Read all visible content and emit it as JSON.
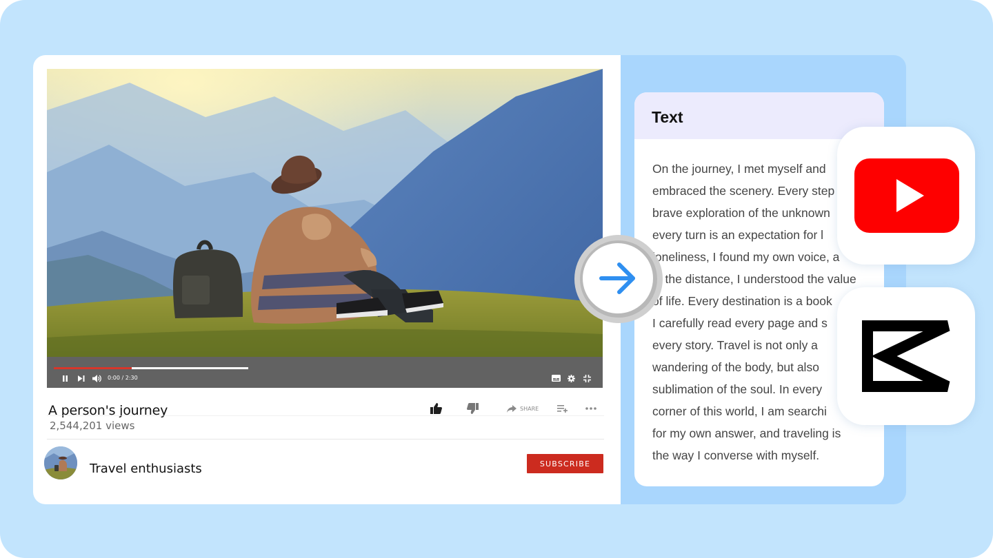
{
  "video": {
    "time": "0:00 / 2:30",
    "progress": 0.4,
    "played": 0.4,
    "title": "A person's journey",
    "views": "2,544,201 views",
    "share_label": "SHARE",
    "channel_name": "Travel enthusiasts",
    "subscribe_label": "SUBSCRIBE"
  },
  "text_panel": {
    "title": "Text",
    "lines": [
      "On the journey, I met myself and",
      "embraced the scenery. Every step",
      "brave exploration of the unknown",
      "every turn is an expectation for l",
      "loneliness, I found my own voice, a",
      "in the distance, I understood the value",
      "of life. Every destination is a book",
      "I carefully read every page and s",
      "every story. Travel is not only a",
      "wandering of the body, but also",
      "sublimation of the soul. In every",
      "corner of this world, I am searchi",
      "for my own answer, and traveling is",
      "the way I converse with myself."
    ]
  },
  "icons": {
    "arrow": "arrow-right-icon",
    "youtube": "youtube-logo-icon",
    "capcut": "capcut-logo-icon",
    "pause": "pause-icon",
    "next": "skip-next-icon",
    "volume": "volume-icon",
    "captions": "captions-icon",
    "settings": "gear-icon",
    "fullscreen": "exit-fullscreen-icon",
    "like": "thumbs-up-icon",
    "dislike": "thumbs-down-icon",
    "share": "share-icon",
    "playlist": "add-to-playlist-icon",
    "more": "more-horizontal-icon"
  },
  "colors": {
    "background": "#c2e4fd",
    "panel_blue": "#a9d6fd",
    "subscribe_red": "#cc2b1f",
    "progress_red": "#d8362a",
    "youtube_red": "#fe0000",
    "arrow_blue": "#2f8ff0"
  }
}
